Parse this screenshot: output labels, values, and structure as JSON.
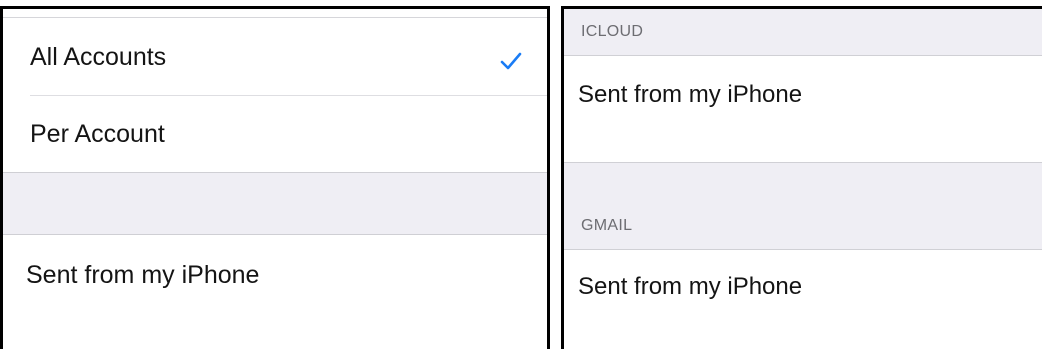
{
  "left_panel": {
    "options": [
      {
        "label": "All Accounts",
        "selected": true
      },
      {
        "label": "Per Account",
        "selected": false
      }
    ],
    "signature": "Sent from my iPhone"
  },
  "right_panel": {
    "sections": [
      {
        "header": "ICLOUD",
        "signature": "Sent from my iPhone"
      },
      {
        "header": "GMAIL",
        "signature": "Sent from my iPhone"
      }
    ]
  },
  "colors": {
    "accent": "#1a7cf5",
    "group_background": "#efeef4",
    "header_text": "#6d6d72"
  },
  "icons": {
    "selected": "checkmark-icon"
  }
}
